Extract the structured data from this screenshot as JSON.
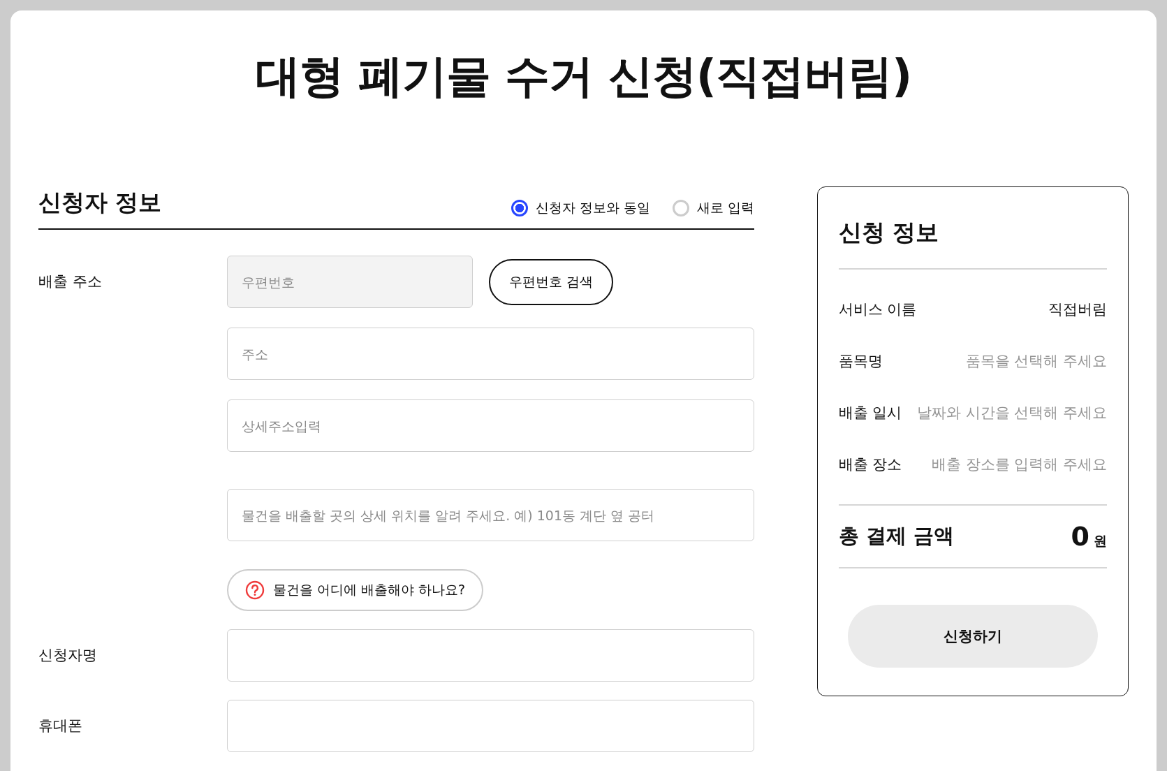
{
  "title": "대형 폐기물 수거 신청(직접버림)",
  "applicant": {
    "heading": "신청자 정보",
    "options": [
      {
        "label": "신청자 정보와 동일",
        "selected": true
      },
      {
        "label": "새로 입력",
        "selected": false
      }
    ],
    "address": {
      "label": "배출 주소",
      "postcode": {
        "placeholder": "우편번호"
      },
      "search_button": "우편번호 검색",
      "fields": [
        {
          "placeholder": "주소"
        },
        {
          "placeholder": "상세주소입력"
        },
        {
          "placeholder": "물건을 배출할 곳의 상세 위치를 알려 주세요. 예) 101동 계단 옆 공터"
        }
      ],
      "help_button": "물건을 어디에 배출해야 하나요?"
    },
    "name": {
      "label": "신청자명"
    },
    "phone": {
      "label": "휴대폰"
    }
  },
  "summary": {
    "heading": "신청 정보",
    "rows": [
      {
        "label": "서비스 이름",
        "value": "직접버림",
        "empty": false
      },
      {
        "label": "품목명",
        "value": "품목을 선택해 주세요",
        "empty": true
      },
      {
        "label": "배출 일시",
        "value": "날짜와 시간을 선택해 주세요",
        "empty": true
      },
      {
        "label": "배출 장소",
        "value": "배출 장소를 입력해 주세요",
        "empty": true
      }
    ],
    "total_label": "총 결제 금액",
    "total_amount": "0",
    "currency": "원",
    "submit_button": "신청하기"
  }
}
